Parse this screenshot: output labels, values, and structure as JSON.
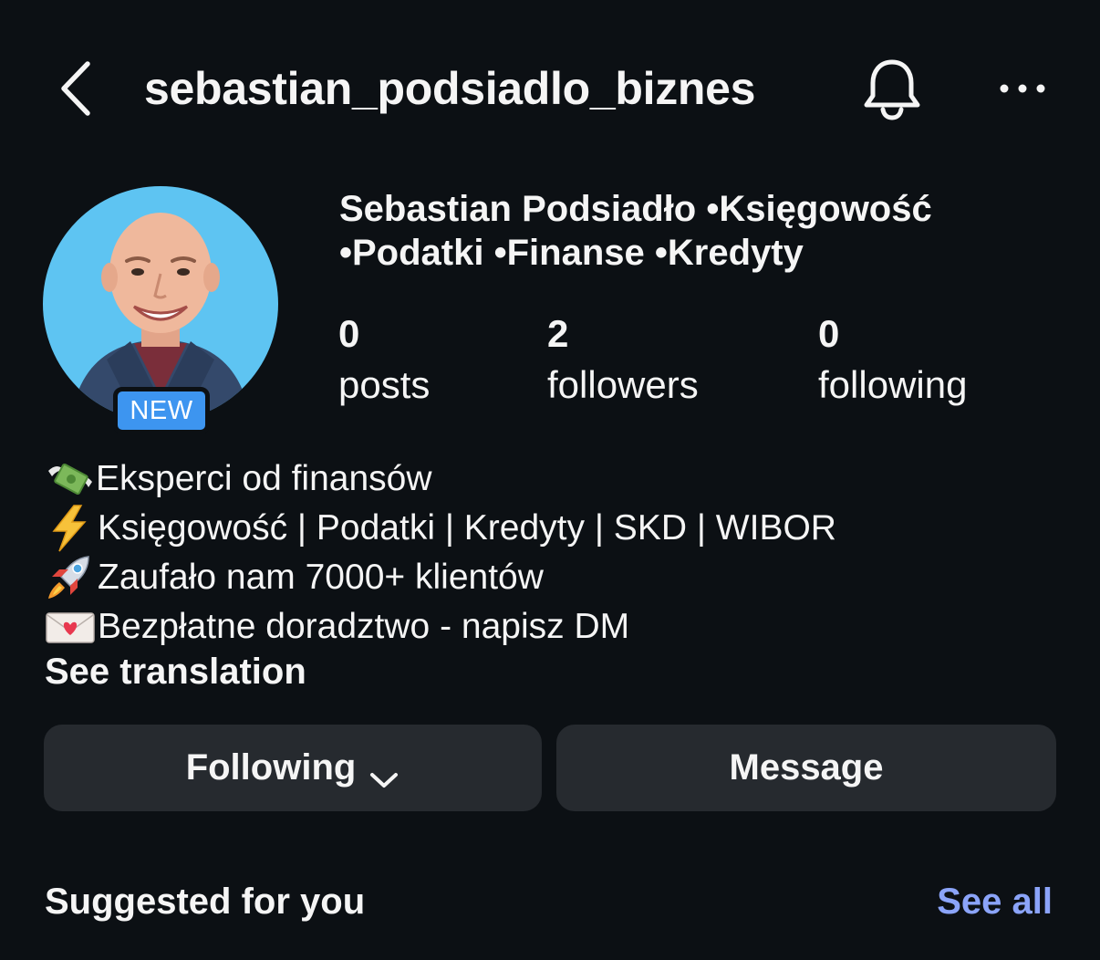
{
  "header": {
    "username": "sebastian_podsiadlo_biznes",
    "back_icon": "chevron-left-icon",
    "notification_icon": "bell-icon",
    "more_icon": "more-horizontal-icon"
  },
  "profile": {
    "name_line1": "Sebastian Podsiadło •Księgowość",
    "name_line2": "•Podatki •Finanse •Kredyty",
    "badge": "NEW",
    "avatar_bg_color": "#5ec4f2",
    "stats": {
      "posts": {
        "value": "0",
        "label": "posts"
      },
      "followers": {
        "value": "2",
        "label": "followers"
      },
      "following": {
        "value": "0",
        "label": "following"
      }
    }
  },
  "bio": {
    "lines": [
      {
        "icon": "money-with-wings-icon",
        "text": " Eksperci od finansów"
      },
      {
        "icon": "lightning-icon",
        "text": "Księgowość | Podatki | Kredyty | SKD | WIBOR"
      },
      {
        "icon": "rocket-icon",
        "text": "Zaufało nam 7000+ klientów"
      },
      {
        "icon": "love-letter-icon",
        "text": "Bezpłatne doradztwo - napisz DM"
      }
    ],
    "see_translation": "See translation"
  },
  "actions": {
    "following_label": "Following",
    "message_label": "Message"
  },
  "suggested": {
    "title": "Suggested for you",
    "see_all": "See all"
  },
  "colors": {
    "background": "#0c1014",
    "button_bg": "#262a2f",
    "badge_blue": "#3d95f0",
    "link": "#8ba4f9"
  }
}
